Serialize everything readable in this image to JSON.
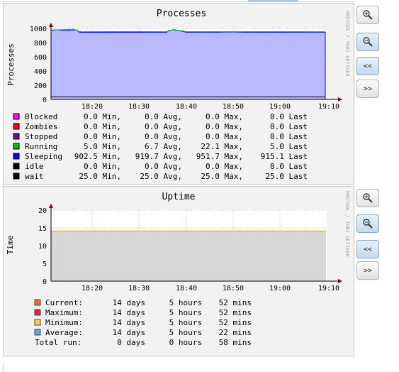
{
  "graphs": [
    {
      "title": "Processes",
      "ylabel": "Processes",
      "watermark": "RRDTOOL / TOBI OETIKER",
      "x_ticks": [
        "18:20",
        "18:30",
        "18:40",
        "18:50",
        "19:00",
        "19:10"
      ],
      "y_ticks": [
        "1000",
        "800",
        "600",
        "400",
        "200",
        "0"
      ],
      "legend": [
        {
          "name": "Blocked",
          "color": "#ff00ff",
          "min": "0.0 Min,",
          "avg": "0.0 Avg,",
          "max": "0.0 Max,",
          "last": "0.0 Last"
        },
        {
          "name": "Zombies",
          "color": "#ff0000",
          "min": "0.0 Min,",
          "avg": "0.0 Avg,",
          "max": "0.0 Max,",
          "last": "0.0 Last"
        },
        {
          "name": "Stopped",
          "color": "#800080",
          "min": "0.0 Min,",
          "avg": "0.0 Avg,",
          "max": "0.0 Max,",
          "last": "0.0 Last"
        },
        {
          "name": "Running",
          "color": "#00c000",
          "min": "5.0 Min,",
          "avg": "6.7 Avg,",
          "max": "22.1 Max,",
          "last": "5.0 Last"
        },
        {
          "name": "Sleeping",
          "color": "#0000ff",
          "min": "902.5 Min,",
          "avg": "919.7 Avg,",
          "max": "951.7 Max,",
          "last": "915.1 Last"
        },
        {
          "name": "idle",
          "color": "#000000",
          "min": "0.0 Min,",
          "avg": "0.0 Avg,",
          "max": "0.0 Max,",
          "last": "0.0 Last"
        },
        {
          "name": "wait",
          "color": "#000000",
          "min": "25.0 Min,",
          "avg": "25.0 Avg,",
          "max": "25.0 Max,",
          "last": "25.0 Last"
        }
      ]
    },
    {
      "title": "Uptime",
      "ylabel": "Time",
      "watermark": "RRDTOOL / TOBI OETIKER",
      "x_ticks": [
        "18:20",
        "18:30",
        "18:40",
        "18:50",
        "19:00",
        "19:10"
      ],
      "y_ticks": [
        "20",
        "15",
        "10",
        "5",
        "0"
      ],
      "legend": [
        {
          "name": "Current:",
          "color": "#ff6a3a",
          "days": "14 days",
          "hours": "5 hours",
          "mins": "52 mins"
        },
        {
          "name": "Maximum:",
          "color": "#e8203a",
          "days": "14 days",
          "hours": "5 hours",
          "mins": "52 mins"
        },
        {
          "name": "Minimum:",
          "color": "#ffd24a",
          "days": "14 days",
          "hours": "5 hours",
          "mins": "52 mins"
        },
        {
          "name": "Average:",
          "color": "#5fa8e8",
          "days": "14 days",
          "hours": "5 hours",
          "mins": "22 mins"
        }
      ],
      "total": {
        "name": "Total run:",
        "days": "0 days",
        "hours": "0 hours",
        "mins": "58 mins"
      }
    }
  ],
  "buttons": {
    "zoom_in": "zoom-in-icon",
    "zoom_out": "zoom-out-icon",
    "back": "<<",
    "forward": ">>"
  }
}
